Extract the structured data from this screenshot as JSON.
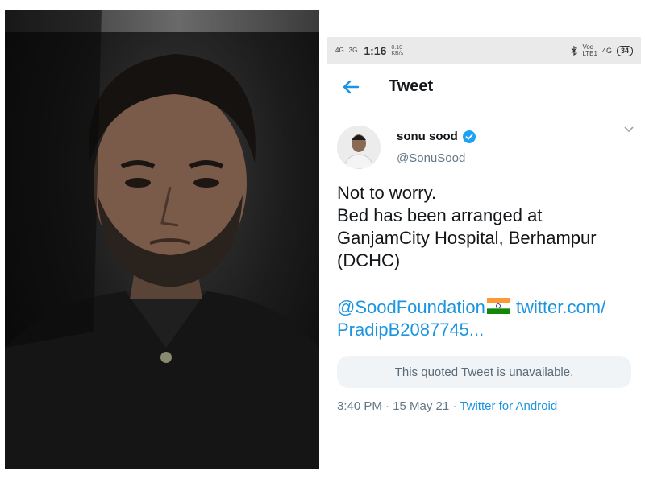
{
  "phone": {
    "status_bar": {
      "network_top": "4G",
      "network_bottom": "3G",
      "time": "1:16",
      "speed_value": "0.10",
      "speed_unit": "KB/s",
      "carrier_top": "Vod",
      "carrier_bottom": "LTE1",
      "signal_right": "4G",
      "battery": "34"
    },
    "header": {
      "title": "Tweet"
    },
    "tweet": {
      "author_name": "sonu sood",
      "handle": "@SonuSood",
      "lines": [
        "Not to worry.",
        "Bed has been arranged at",
        "GanjamCity Hospital, Berhampur",
        "(DCHC)"
      ],
      "mention": "@SoodFoundation",
      "link_part1": "twitter.com/",
      "link_part2": "PradipB2087745...",
      "quoted_text": "This quoted Tweet is unavailable.",
      "timestamp": "3:40 PM · 15 May 21 · ",
      "source_app": "Twitter for Android"
    }
  },
  "colors": {
    "link": "#1b95e0",
    "verified": "#1da1f2",
    "text": "#14171a",
    "muted": "#657786"
  },
  "icons": [
    "back-arrow-icon",
    "verified-badge-icon",
    "chevron-down-icon",
    "india-flag-icon",
    "battery-icon",
    "bluetooth-icon"
  ]
}
